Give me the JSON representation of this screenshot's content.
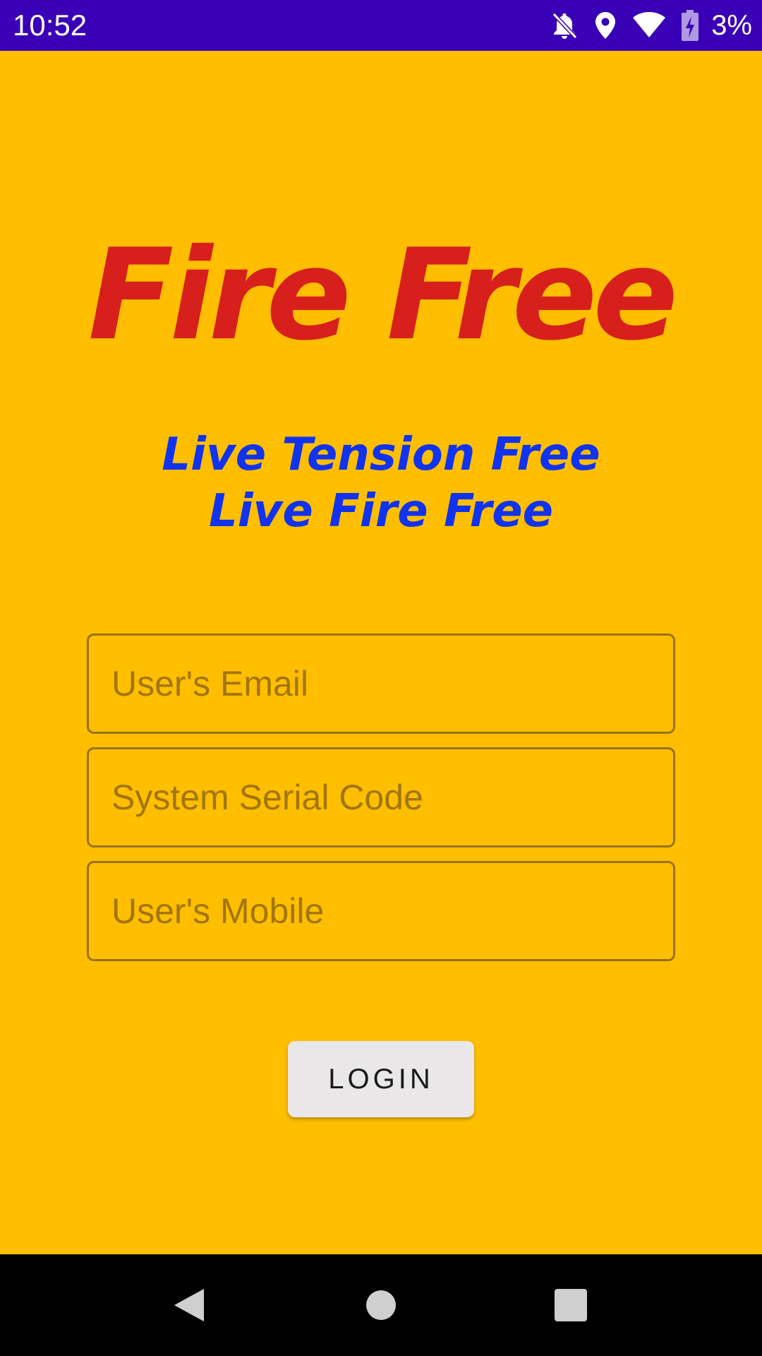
{
  "status_bar": {
    "time": "10:52",
    "battery_percent": "3%",
    "icons": [
      "notifications-off-icon",
      "location-icon",
      "wifi-icon",
      "battery-charging-icon"
    ]
  },
  "app": {
    "title": "Fire Free",
    "tagline_line1": "Live Tension Free",
    "tagline_line2": "Live Fire Free"
  },
  "form": {
    "email_placeholder": "User's Email",
    "serial_placeholder": "System Serial Code",
    "mobile_placeholder": "User's Mobile",
    "login_label": "LOGIN"
  },
  "nav_bar": {
    "icons": [
      "back-icon",
      "home-icon",
      "recents-icon"
    ]
  },
  "colors": {
    "background": "#FFBE00",
    "status_bar": "#3A00B6",
    "title": "#D71F1B",
    "tagline": "#1133EE",
    "field_border": "#9A7210",
    "button": "#E9E7E7"
  }
}
